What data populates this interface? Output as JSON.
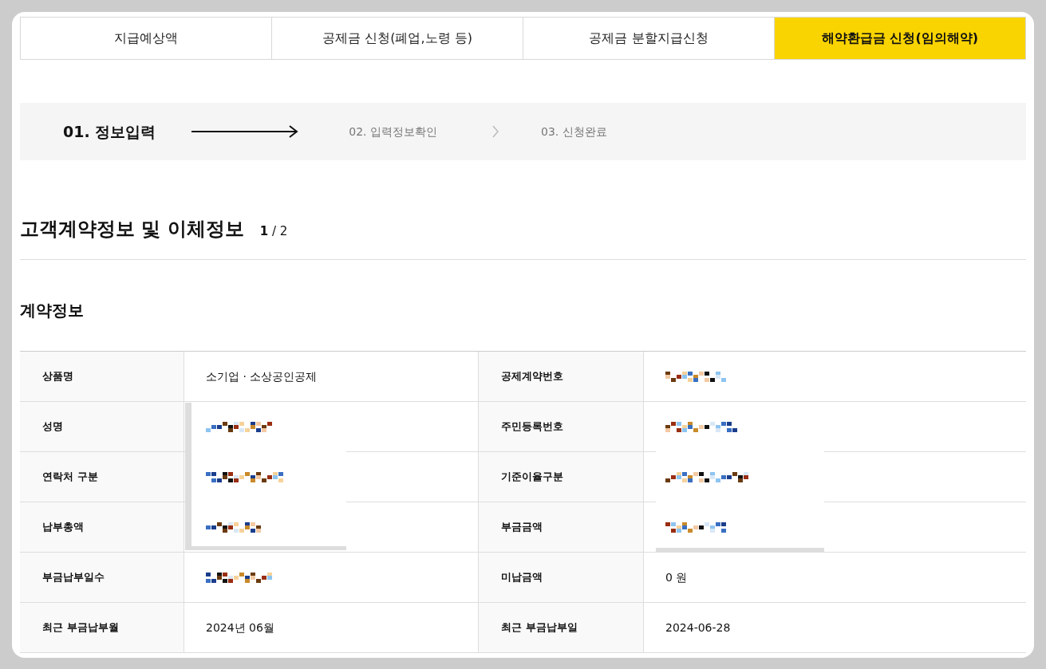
{
  "tabs": [
    {
      "label": "지급예상액",
      "selected": false
    },
    {
      "label": "공제금 신청(폐업,노령 등)",
      "selected": false
    },
    {
      "label": "공제금 분할지급신청",
      "selected": false
    },
    {
      "label": "해약환급금 신청(임의해약)",
      "selected": true
    }
  ],
  "steps": [
    {
      "label": "01. 정보입력",
      "selected": true
    },
    {
      "label": "02. 입력정보확인",
      "selected": false
    },
    {
      "label": "03. 신청완료",
      "selected": false
    }
  ],
  "section": {
    "title": "고객계약정보 및 이체정보",
    "page_current": "1",
    "page_total": "/ 2"
  },
  "subsection": {
    "title": "계약정보"
  },
  "rows": [
    {
      "cells": [
        {
          "label": "상품명",
          "value": "소기업 · 소상공인공제"
        },
        {
          "label": "공제계약번호",
          "redacted": true
        }
      ]
    },
    {
      "cells": [
        {
          "label": "성명",
          "redacted": true
        },
        {
          "label": "주민등록번호",
          "redacted": true
        }
      ]
    },
    {
      "cells": [
        {
          "label": "연락처 구분",
          "redacted": true
        },
        {
          "label": "기준이율구분",
          "redacted": true
        }
      ]
    },
    {
      "cells": [
        {
          "label": "납부총액",
          "redacted": true
        },
        {
          "label": "부금금액",
          "redacted": true
        }
      ]
    },
    {
      "cells": [
        {
          "label": "부금납부일수",
          "redacted": true
        },
        {
          "label": "미납금액",
          "value": "0 원"
        }
      ]
    },
    {
      "cells": [
        {
          "label": "최근 부금납부월",
          "value": "2024년 06월"
        },
        {
          "label": "최근 부금납부일",
          "value": "2024-06-28"
        }
      ]
    }
  ]
}
